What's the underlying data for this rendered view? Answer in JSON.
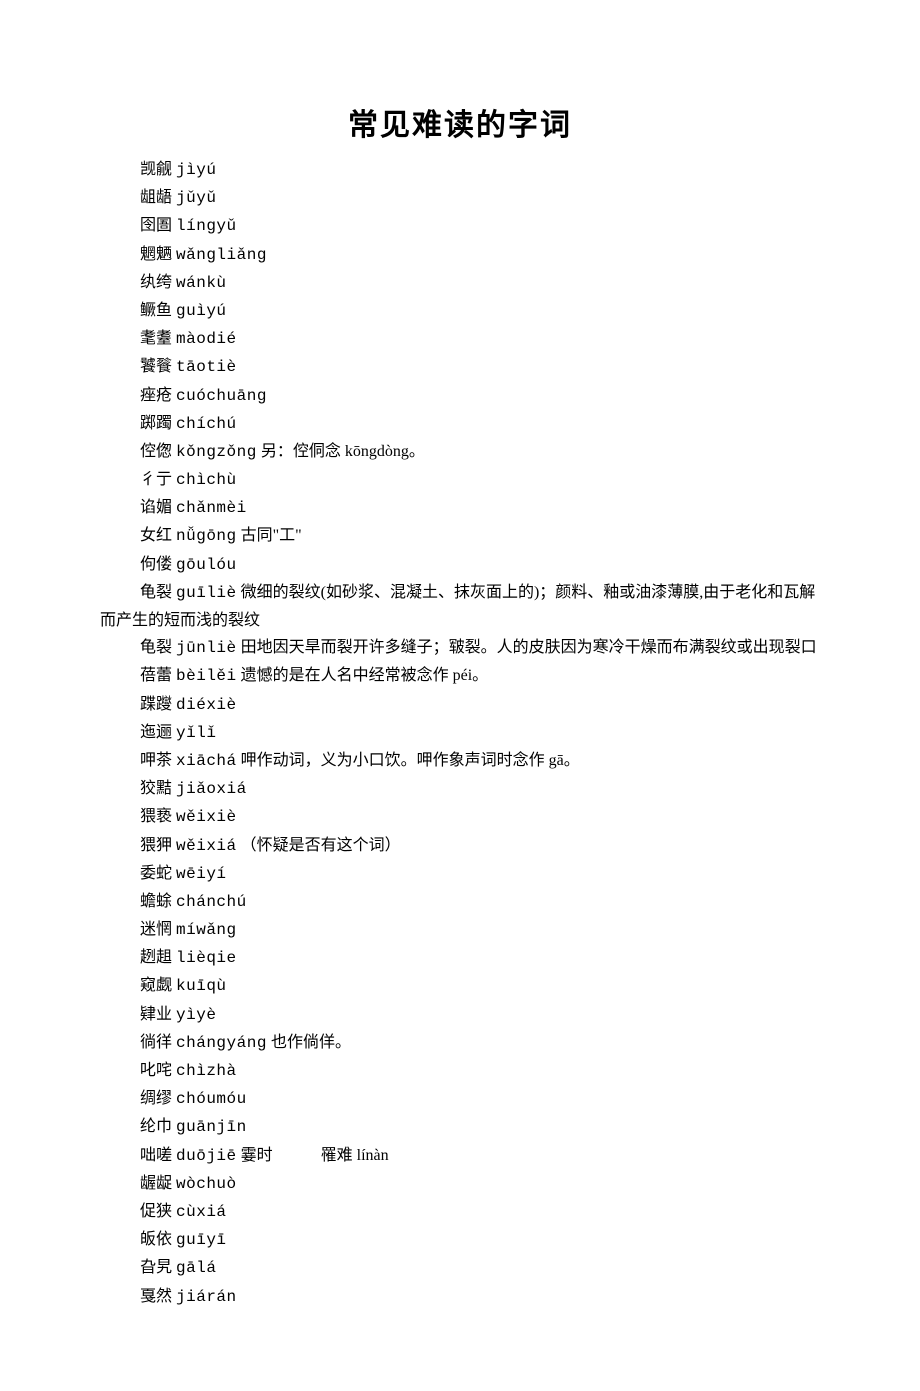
{
  "title": "常见难读的字词",
  "entries": [
    {
      "hanzi": "觊觎",
      "pinyin": "jìyú",
      "note": ""
    },
    {
      "hanzi": "龃龉",
      "pinyin": "jǔyǔ",
      "note": ""
    },
    {
      "hanzi": "囹圄",
      "pinyin": "língyǔ",
      "note": ""
    },
    {
      "hanzi": "魍魉",
      "pinyin": "wǎngliǎng",
      "note": ""
    },
    {
      "hanzi": "纨绔",
      "pinyin": "wánkù",
      "note": ""
    },
    {
      "hanzi": "鳜鱼",
      "pinyin": "guìyú",
      "note": ""
    },
    {
      "hanzi": "耄耋",
      "pinyin": "màodié",
      "note": ""
    },
    {
      "hanzi": "饕餮",
      "pinyin": "tāotiè",
      "note": ""
    },
    {
      "hanzi": "痤疮",
      "pinyin": "cuóchuāng",
      "note": ""
    },
    {
      "hanzi": "踯躅",
      "pinyin": "chíchú",
      "note": ""
    },
    {
      "hanzi": "倥偬",
      "pinyin": "kǒngzǒng",
      "note": "另：倥侗念 kōngdòng。"
    },
    {
      "hanzi": "彳亍",
      "pinyin": "chìchù",
      "note": ""
    },
    {
      "hanzi": "谄媚",
      "pinyin": "chǎnmèi",
      "note": ""
    },
    {
      "hanzi": "女红",
      "pinyin": "nǚgōng",
      "note": "古同\"工\""
    },
    {
      "hanzi": "佝偻",
      "pinyin": "gōulóu",
      "note": ""
    },
    {
      "hanzi": "龟裂",
      "pinyin": "guīliè",
      "note": "微细的裂纹(如砂浆、混凝土、抹灰面上的)；颜料、釉或油漆薄膜,由于老化和瓦解而产生的短而浅的裂纹",
      "wrap": true
    },
    {
      "hanzi": "龟裂",
      "pinyin": "jūnliè",
      "note": "田地因天旱而裂开许多缝子；皲裂。人的皮肤因为寒冷干燥而布满裂纹或出现裂口",
      "wrap": true
    },
    {
      "hanzi": "蓓蕾",
      "pinyin": "bèilěi",
      "note": "遗憾的是在人名中经常被念作 péi。"
    },
    {
      "hanzi": "蹀躞",
      "pinyin": "diéxiè",
      "note": ""
    },
    {
      "hanzi": "迤逦",
      "pinyin": "yǐlǐ",
      "note": ""
    },
    {
      "hanzi": "呷茶",
      "pinyin": "xiāchá",
      "note": "呷作动词，义为小口饮。呷作象声词时念作 gā。"
    },
    {
      "hanzi": "狡黠",
      "pinyin": "jiǎoxiá",
      "note": ""
    },
    {
      "hanzi": "猥亵",
      "pinyin": "wěixiè",
      "note": ""
    },
    {
      "hanzi": "猥狎",
      "pinyin": "wěixiá",
      "note": "（怀疑是否有这个词）"
    },
    {
      "hanzi": "委蛇",
      "pinyin": "wēiyí",
      "note": ""
    },
    {
      "hanzi": "蟾蜍",
      "pinyin": "chánchú",
      "note": ""
    },
    {
      "hanzi": "迷惘",
      "pinyin": "míwǎng",
      "note": ""
    },
    {
      "hanzi": "趔趄",
      "pinyin": "lièqie",
      "note": ""
    },
    {
      "hanzi": "窥觑",
      "pinyin": "kuīqù",
      "note": ""
    },
    {
      "hanzi": "肄业",
      "pinyin": "yìyè",
      "note": ""
    },
    {
      "hanzi": "徜徉",
      "pinyin": "chángyáng",
      "note": "也作倘佯。"
    },
    {
      "hanzi": "叱咤",
      "pinyin": "chìzhà",
      "note": ""
    },
    {
      "hanzi": "绸缪",
      "pinyin": "chóumóu",
      "note": ""
    },
    {
      "hanzi": "纶巾",
      "pinyin": "guānjīn",
      "note": ""
    },
    {
      "hanzi": "咄嗟",
      "pinyin": "duōjiē",
      "note": "霎时　　　罹难 línàn"
    },
    {
      "hanzi": "龌龊",
      "pinyin": "wòchuò",
      "note": ""
    },
    {
      "hanzi": "促狭",
      "pinyin": "cùxiá",
      "note": ""
    },
    {
      "hanzi": "皈依",
      "pinyin": "guīyī",
      "note": ""
    },
    {
      "hanzi": "旮旯",
      "pinyin": "gālá",
      "note": ""
    },
    {
      "hanzi": "戛然",
      "pinyin": "jiárán",
      "note": ""
    }
  ]
}
